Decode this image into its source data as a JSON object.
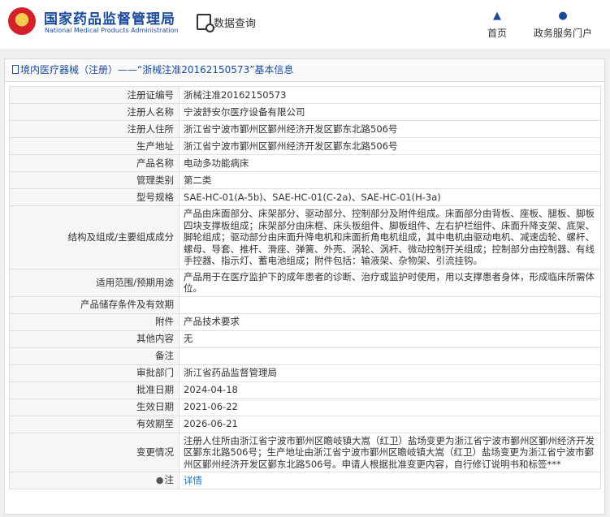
{
  "header": {
    "brand_cn": "国家药品监督管理局",
    "brand_en": "National Medical Products Administration",
    "query_label": "数据查询",
    "nav_home": "首页",
    "nav_service": "政务服务门户"
  },
  "breadcrumb": "境内医疗器械（注册）——“浙械注准20162150573”基本信息",
  "rows": [
    {
      "label": "注册证编号",
      "value": "浙械注准20162150573"
    },
    {
      "label": "注册人名称",
      "value": "宁波舒安尔医疗设备有限公司"
    },
    {
      "label": "注册人住所",
      "value": "浙江省宁波市鄞州区鄞州经济开发区鄞东北路506号"
    },
    {
      "label": "生产地址",
      "value": "浙江省宁波市鄞州区鄞州经济开发区鄞东北路506号"
    },
    {
      "label": "产品名称",
      "value": "电动多功能病床"
    },
    {
      "label": "管理类别",
      "value": "第二类"
    },
    {
      "label": "型号规格",
      "value": "SAE-HC-01(A-5b)、SAE-HC-01(C-2a)、SAE-HC-01(H-3a)"
    },
    {
      "label": "结构及组成/主要组成成分",
      "value": "产品由床面部分、床架部分、驱动部分、控制部分及附件组成。床面部分由背板、座板、腿板、脚板四块支撑板组成；床架部分由床框、床头板组件、脚板组件、左右护栏组件、床面升降支架、底架、脚轮组成；驱动部分由床面升降电机和床面折角电机组成，其中电机由驱动电机、减速齿轮、螺杆、螺母、导套、推杆、滑座、弹簧、外壳、涡轮、涡杆、微动控制开关组成；控制部分由控制器、有线手控器、指示灯、蓄电池组成；附件包括：输液架、杂物架、引流挂钩。"
    },
    {
      "label": "适用范围/预期用途",
      "value": "产品用于在医疗监护下的成年患者的诊断、治疗或监护时使用，用以支撑患者身体，形成临床所需体位。"
    },
    {
      "label": "产品储存条件及有效期",
      "value": ""
    },
    {
      "label": "附件",
      "value": "产品技术要求"
    },
    {
      "label": "其他内容",
      "value": "无"
    },
    {
      "label": "备注",
      "value": ""
    },
    {
      "label": "审批部门",
      "value": "浙江省药品监督管理局"
    },
    {
      "label": "批准日期",
      "value": "2024-04-18"
    },
    {
      "label": "生效日期",
      "value": "2021-06-22"
    },
    {
      "label": "有效期至",
      "value": "2026-06-21"
    },
    {
      "label": "变更情况",
      "value": "注册人住所由浙江省宁波市鄞州区瞻岐镇大嵩（红卫）盐场变更为浙江省宁波市鄞州区鄞州经济开发区鄞东北路506号；生产地址由浙江省宁波市鄞州区瞻岐镇大嵩（红卫）盐场变更为浙江省宁波市鄞州区鄞州经济开发区鄞东北路506号。申请人根据批准变更内容，自行修订说明书和标签***"
    }
  ],
  "note": {
    "label": "注",
    "link": "详情"
  },
  "colors": {
    "brand_blue": "#1a4a9c",
    "link_blue": "#1a6fc4",
    "logo_red": "#d4202a"
  }
}
